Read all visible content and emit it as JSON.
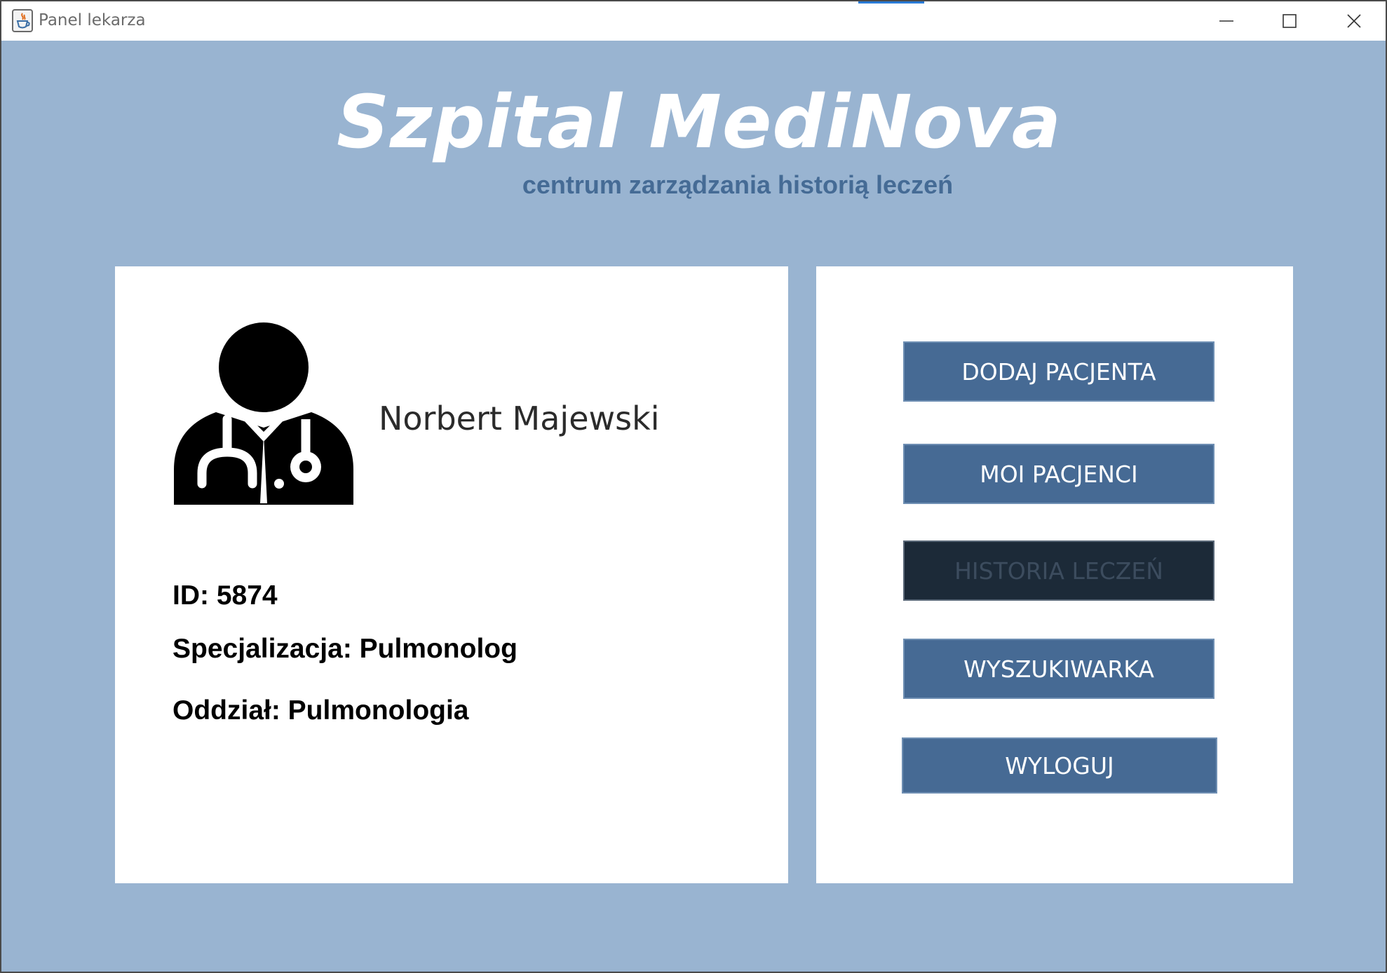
{
  "window": {
    "title": "Panel lekarza",
    "icon": "java-cup-icon"
  },
  "header": {
    "title": "Szpital MediNova",
    "subtitle": "centrum zarządzania historią leczeń"
  },
  "doctor": {
    "name": "Norbert Majewski",
    "id_label": "ID: 5874",
    "specialization_label": "Specjalizacja: Pulmonolog",
    "department_label": "Oddział: Pulmonologia",
    "avatar_icon": "doctor-stethoscope-icon"
  },
  "menu": {
    "add_patient": "DODAJ PACJENTA",
    "my_patients": "MOI PACJENCI",
    "treatment_history": "HISTORIA LECZEŃ",
    "search": "WYSZUKIWARKA",
    "logout": "WYLOGUJ"
  },
  "colors": {
    "background": "#99b4d1",
    "button": "#466a94",
    "button_disabled": "#1c2a38",
    "subtitle": "#456b95"
  }
}
